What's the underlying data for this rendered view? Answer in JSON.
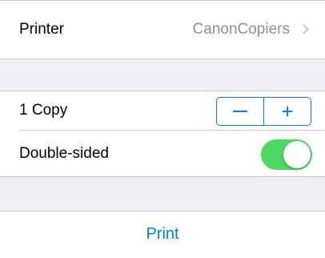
{
  "printer": {
    "label": "Printer",
    "value": "CanonCopiers"
  },
  "copies": {
    "label": "1 Copy",
    "count": 1
  },
  "double_sided": {
    "label": "Double-sided",
    "enabled": true
  },
  "actions": {
    "print_label": "Print"
  },
  "colors": {
    "accent": "#007aff",
    "toggle_on": "#4cd964",
    "background": "#efeff4",
    "secondary_text": "#8e8e93"
  },
  "icons": {
    "printer_chevron": "chevron-right-icon",
    "decrement": "minus-icon",
    "increment": "plus-icon"
  }
}
